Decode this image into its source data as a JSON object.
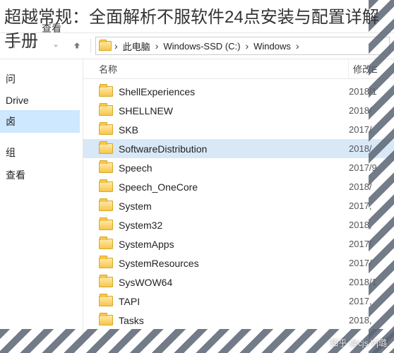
{
  "overlay_title": "超越常规：全面解析不服软件24点安装与配置详解手册",
  "menubar": {
    "view": "查看"
  },
  "breadcrumb": {
    "this_pc": "此电脑",
    "drive": "Windows-SSD (C:)",
    "folder": "Windows"
  },
  "sidebar": {
    "items": [
      "问",
      "Drive",
      "卤",
      "",
      "组",
      "查看"
    ]
  },
  "columns": {
    "name": "名称",
    "date": "修改E"
  },
  "rows": [
    {
      "name": "ShellExperiences",
      "date": "2018/1",
      "selected": false
    },
    {
      "name": "SHELLNEW",
      "date": "2018/",
      "selected": false
    },
    {
      "name": "SKB",
      "date": "2017/",
      "selected": false
    },
    {
      "name": "SoftwareDistribution",
      "date": "2018/",
      "selected": true
    },
    {
      "name": "Speech",
      "date": "2017/9",
      "selected": false
    },
    {
      "name": "Speech_OneCore",
      "date": "2018/",
      "selected": false
    },
    {
      "name": "System",
      "date": "2017,",
      "selected": false
    },
    {
      "name": "System32",
      "date": "2018,",
      "selected": false
    },
    {
      "name": "SystemApps",
      "date": "2017/",
      "selected": false
    },
    {
      "name": "SystemResources",
      "date": "2017/",
      "selected": false
    },
    {
      "name": "SysWOW64",
      "date": "2018/1",
      "selected": false
    },
    {
      "name": "TAPI",
      "date": "2017,",
      "selected": false
    },
    {
      "name": "Tasks",
      "date": "2018,",
      "selected": false
    }
  ],
  "watermark": "知乎 @cjs.V|璐"
}
